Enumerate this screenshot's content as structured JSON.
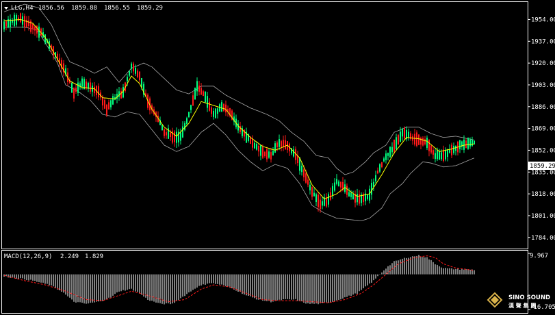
{
  "colors": {
    "background": "#000000",
    "frame": "#ffffff",
    "bull": "#00ff7f",
    "bear": "#ff1a1a",
    "ma": "#ffff00",
    "bands": "#a8a8a8",
    "macd_hist": "#ffffff",
    "macd_signal": "#ff1a1a",
    "price_tag": "#ffffff",
    "price_tag_text": "#000000"
  },
  "header": {
    "symbol": "LLG,H4",
    "open": "1856.56",
    "high": "1859.88",
    "low": "1856.55",
    "close": "1859.29"
  },
  "macd_header": {
    "label": "MACD(12,26,9)",
    "main": "2.249",
    "signal": "1.829"
  },
  "logo": {
    "line1": "SINO SOUND",
    "line2": "漢 聲 集 團"
  },
  "chart_data": [
    {
      "type": "candlestick",
      "title": "LLG,H4",
      "ylim": [
        1778,
        1966
      ],
      "y_ticks": [
        "1954.00",
        "1937.00",
        "1920.00",
        "1903.00",
        "1886.00",
        "1869.00",
        "1852.00",
        "1835.00",
        "1818.00",
        "1801.00",
        "1784.00"
      ],
      "y_tick_values": [
        1954,
        1937,
        1920,
        1903,
        1886,
        1869,
        1852,
        1835,
        1818,
        1801,
        1784
      ],
      "current_price": "1859.29",
      "current_price_value": 1859.29,
      "path": [
        [
          0,
          1950
        ],
        [
          8,
          1955
        ],
        [
          13,
          1949
        ],
        [
          18,
          1944
        ],
        [
          24,
          1930
        ],
        [
          30,
          1913
        ],
        [
          34,
          1897
        ],
        [
          38,
          1905
        ],
        [
          42,
          1901
        ],
        [
          46,
          1898
        ],
        [
          50,
          1884
        ],
        [
          54,
          1893
        ],
        [
          58,
          1897
        ],
        [
          62,
          1918
        ],
        [
          66,
          1910
        ],
        [
          70,
          1890
        ],
        [
          74,
          1880
        ],
        [
          78,
          1866
        ],
        [
          82,
          1863
        ],
        [
          86,
          1862
        ],
        [
          90,
          1880
        ],
        [
          94,
          1902
        ],
        [
          98,
          1893
        ],
        [
          102,
          1880
        ],
        [
          106,
          1886
        ],
        [
          110,
          1882
        ],
        [
          114,
          1870
        ],
        [
          118,
          1863
        ],
        [
          122,
          1856
        ],
        [
          126,
          1850
        ],
        [
          130,
          1848
        ],
        [
          134,
          1858
        ],
        [
          138,
          1856
        ],
        [
          142,
          1848
        ],
        [
          146,
          1834
        ],
        [
          150,
          1820
        ],
        [
          154,
          1810
        ],
        [
          158,
          1813
        ],
        [
          162,
          1828
        ],
        [
          166,
          1822
        ],
        [
          170,
          1815
        ],
        [
          174,
          1814
        ],
        [
          178,
          1817
        ],
        [
          182,
          1835
        ],
        [
          186,
          1847
        ],
        [
          190,
          1855
        ],
        [
          194,
          1866
        ],
        [
          198,
          1863
        ],
        [
          202,
          1860
        ],
        [
          206,
          1858
        ],
        [
          210,
          1848
        ],
        [
          214,
          1848
        ],
        [
          218,
          1852
        ],
        [
          222,
          1856
        ],
        [
          226,
          1857
        ],
        [
          229,
          1859.29
        ]
      ],
      "upper_band": [
        [
          0,
          1960
        ],
        [
          10,
          1966
        ],
        [
          17,
          1963
        ],
        [
          23,
          1950
        ],
        [
          28,
          1933
        ],
        [
          32,
          1921
        ],
        [
          38,
          1917
        ],
        [
          44,
          1912
        ],
        [
          50,
          1917
        ],
        [
          56,
          1905
        ],
        [
          62,
          1916
        ],
        [
          68,
          1920
        ],
        [
          72,
          1917
        ],
        [
          78,
          1908
        ],
        [
          84,
          1899
        ],
        [
          90,
          1896
        ],
        [
          96,
          1902
        ],
        [
          102,
          1902
        ],
        [
          108,
          1895
        ],
        [
          114,
          1890
        ],
        [
          120,
          1885
        ],
        [
          128,
          1880
        ],
        [
          134,
          1875
        ],
        [
          140,
          1866
        ],
        [
          146,
          1859
        ],
        [
          152,
          1848
        ],
        [
          158,
          1846
        ],
        [
          162,
          1838
        ],
        [
          166,
          1833
        ],
        [
          170,
          1835
        ],
        [
          176,
          1843
        ],
        [
          180,
          1850
        ],
        [
          186,
          1856
        ],
        [
          190,
          1866
        ],
        [
          196,
          1870
        ],
        [
          202,
          1870
        ],
        [
          208,
          1865
        ],
        [
          214,
          1862
        ],
        [
          220,
          1863
        ],
        [
          226,
          1861
        ],
        [
          229,
          1860
        ]
      ],
      "lower_band": [
        [
          0,
          1948
        ],
        [
          10,
          1948
        ],
        [
          16,
          1946
        ],
        [
          20,
          1936
        ],
        [
          26,
          1920
        ],
        [
          30,
          1903
        ],
        [
          36,
          1898
        ],
        [
          42,
          1891
        ],
        [
          48,
          1880
        ],
        [
          54,
          1878
        ],
        [
          60,
          1882
        ],
        [
          66,
          1880
        ],
        [
          72,
          1868
        ],
        [
          78,
          1856
        ],
        [
          84,
          1851
        ],
        [
          90,
          1855
        ],
        [
          96,
          1866
        ],
        [
          102,
          1873
        ],
        [
          108,
          1864
        ],
        [
          114,
          1852
        ],
        [
          120,
          1843
        ],
        [
          126,
          1836
        ],
        [
          132,
          1841
        ],
        [
          138,
          1838
        ],
        [
          144,
          1826
        ],
        [
          150,
          1809
        ],
        [
          156,
          1803
        ],
        [
          162,
          1799
        ],
        [
          168,
          1798
        ],
        [
          174,
          1797
        ],
        [
          178,
          1799
        ],
        [
          184,
          1807
        ],
        [
          188,
          1818
        ],
        [
          194,
          1826
        ],
        [
          198,
          1834
        ],
        [
          204,
          1843
        ],
        [
          208,
          1842
        ],
        [
          214,
          1839
        ],
        [
          220,
          1840
        ],
        [
          226,
          1844
        ],
        [
          229,
          1846
        ]
      ],
      "moving_average": [
        [
          0,
          1953
        ],
        [
          8,
          1954
        ],
        [
          14,
          1951
        ],
        [
          20,
          1940
        ],
        [
          26,
          1923
        ],
        [
          32,
          1906
        ],
        [
          38,
          1901
        ],
        [
          44,
          1900
        ],
        [
          48,
          1893
        ],
        [
          54,
          1892
        ],
        [
          58,
          1898
        ],
        [
          62,
          1910
        ],
        [
          66,
          1904
        ],
        [
          72,
          1884
        ],
        [
          78,
          1870
        ],
        [
          84,
          1863
        ],
        [
          90,
          1873
        ],
        [
          96,
          1890
        ],
        [
          102,
          1887
        ],
        [
          108,
          1884
        ],
        [
          114,
          1871
        ],
        [
          120,
          1862
        ],
        [
          126,
          1855
        ],
        [
          132,
          1852
        ],
        [
          138,
          1856
        ],
        [
          144,
          1846
        ],
        [
          150,
          1825
        ],
        [
          156,
          1814
        ],
        [
          162,
          1818
        ],
        [
          166,
          1823
        ],
        [
          172,
          1816
        ],
        [
          178,
          1818
        ],
        [
          184,
          1833
        ],
        [
          190,
          1850
        ],
        [
          196,
          1862
        ],
        [
          202,
          1861
        ],
        [
          206,
          1859
        ],
        [
          212,
          1851
        ],
        [
          218,
          1853
        ],
        [
          224,
          1856
        ],
        [
          229,
          1857
        ]
      ]
    },
    {
      "type": "bar",
      "title": "MACD(12,26,9)",
      "ylim": [
        -16.705,
        9.967
      ],
      "y_ticks": [
        "9.967",
        "-16.705"
      ],
      "main_value": "2.249",
      "signal_value": "1.829",
      "histogram": [
        [
          0,
          -1
        ],
        [
          8,
          -2
        ],
        [
          14,
          -3
        ],
        [
          22,
          -5
        ],
        [
          28,
          -8
        ],
        [
          34,
          -13
        ],
        [
          40,
          -14
        ],
        [
          46,
          -13
        ],
        [
          52,
          -11
        ],
        [
          56,
          -8
        ],
        [
          62,
          -7
        ],
        [
          66,
          -9
        ],
        [
          70,
          -12
        ],
        [
          76,
          -14
        ],
        [
          82,
          -14
        ],
        [
          88,
          -10
        ],
        [
          94,
          -6
        ],
        [
          100,
          -4
        ],
        [
          106,
          -5
        ],
        [
          112,
          -7
        ],
        [
          118,
          -10
        ],
        [
          124,
          -12
        ],
        [
          130,
          -13
        ],
        [
          136,
          -12
        ],
        [
          142,
          -12
        ],
        [
          148,
          -14
        ],
        [
          154,
          -14
        ],
        [
          160,
          -13
        ],
        [
          166,
          -11
        ],
        [
          172,
          -9
        ],
        [
          176,
          -6
        ],
        [
          180,
          -3
        ],
        [
          186,
          3
        ],
        [
          190,
          6
        ],
        [
          196,
          8
        ],
        [
          202,
          9
        ],
        [
          206,
          8
        ],
        [
          210,
          5
        ],
        [
          214,
          3
        ],
        [
          220,
          2.5
        ],
        [
          229,
          2.2
        ]
      ],
      "signal": [
        [
          0,
          -0.5
        ],
        [
          10,
          -3
        ],
        [
          20,
          -5
        ],
        [
          30,
          -8
        ],
        [
          40,
          -12
        ],
        [
          48,
          -12.5
        ],
        [
          56,
          -10
        ],
        [
          62,
          -8
        ],
        [
          70,
          -10
        ],
        [
          80,
          -13
        ],
        [
          88,
          -12
        ],
        [
          96,
          -7
        ],
        [
          102,
          -5
        ],
        [
          110,
          -6
        ],
        [
          118,
          -9
        ],
        [
          126,
          -12
        ],
        [
          134,
          -12.5
        ],
        [
          142,
          -12.5
        ],
        [
          150,
          -13
        ],
        [
          158,
          -13.5
        ],
        [
          166,
          -12
        ],
        [
          174,
          -9
        ],
        [
          180,
          -5
        ],
        [
          186,
          0
        ],
        [
          192,
          5
        ],
        [
          200,
          8
        ],
        [
          206,
          8.8
        ],
        [
          210,
          8
        ],
        [
          214,
          5
        ],
        [
          220,
          3
        ],
        [
          229,
          1.9
        ]
      ]
    }
  ]
}
